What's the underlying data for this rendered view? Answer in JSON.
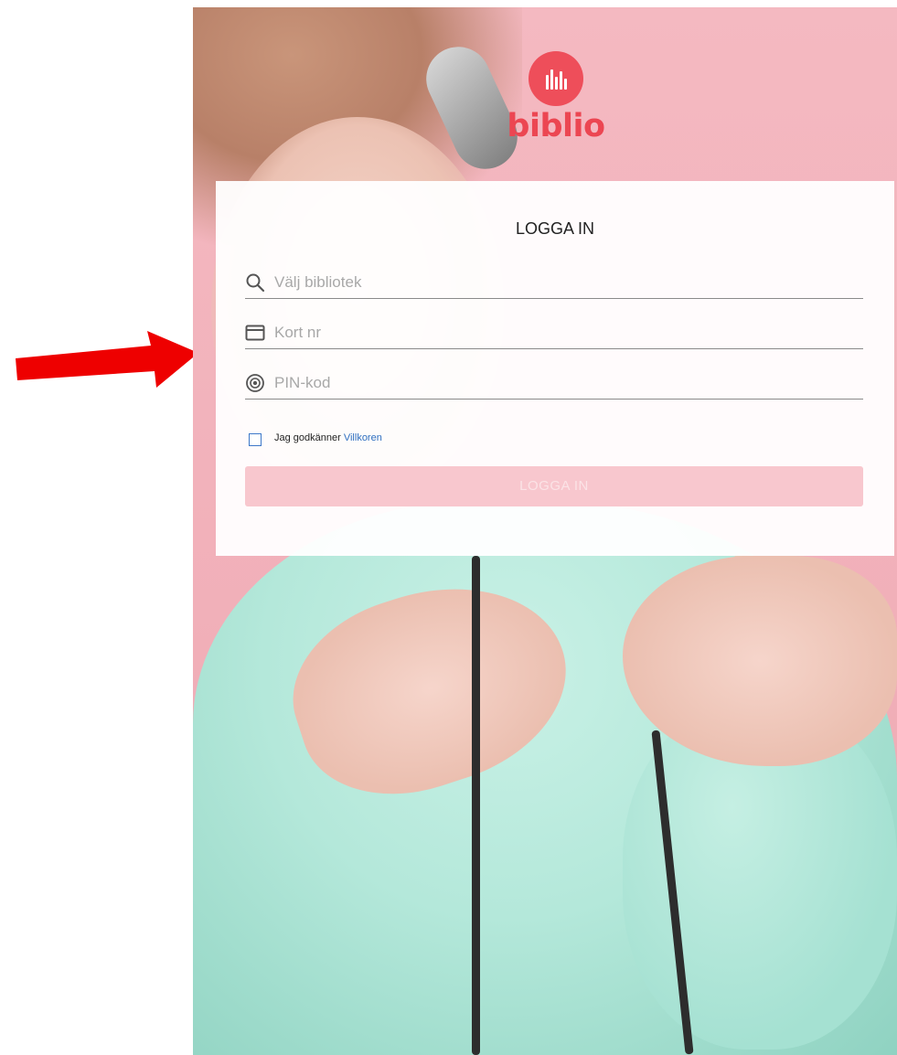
{
  "logo": {
    "text": "biblio"
  },
  "card": {
    "title": "LOGGA IN",
    "fields": [
      {
        "icon": "search-icon",
        "placeholder": "Välj bibliotek"
      },
      {
        "icon": "card-icon",
        "placeholder": "Kort nr"
      },
      {
        "icon": "pin-icon",
        "placeholder": "PIN-kod"
      }
    ],
    "terms": {
      "text": "Jag godkänner",
      "link": "Villkoren",
      "checked": false
    },
    "submit_label": "LOGGA IN"
  },
  "colors": {
    "brand": "#ee4e5a",
    "background": "#f4b9c1",
    "button_disabled": "#f8c7ce",
    "link": "#2f6fc0",
    "arrow": "#ee0000"
  }
}
